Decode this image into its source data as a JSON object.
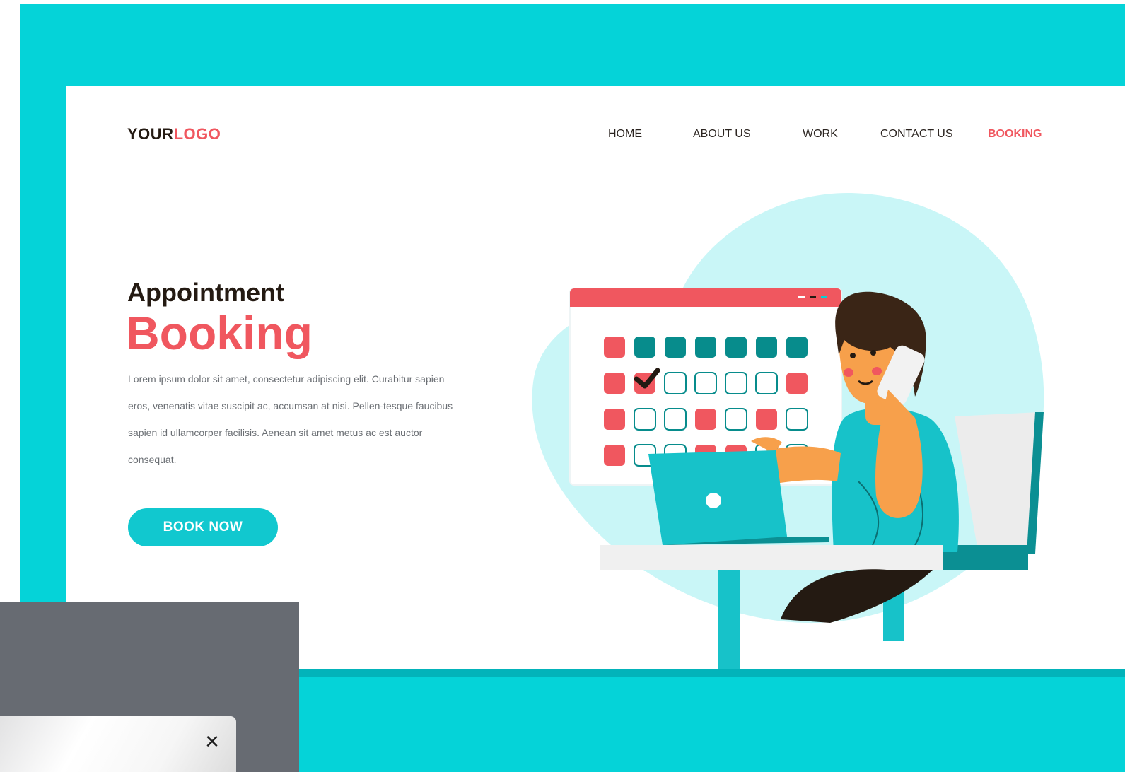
{
  "header": {
    "logo_part1": "YOUR",
    "logo_part2": "LOGO",
    "nav": [
      {
        "label": "HOME"
      },
      {
        "label": "ABOUT US"
      },
      {
        "label": "WORK"
      },
      {
        "label": "CONTACT US"
      },
      {
        "label": "BOOKING",
        "active": true
      }
    ]
  },
  "hero": {
    "title_line1": "Appointment",
    "title_line2": "Booking",
    "body": "Lorem ipsum dolor sit amet, consectetur adipiscing elit. Curabitur sapien eros, venenatis vitae suscipit ac, accumsan at nisi. Pellen-tesque faucibus sapien id ullamcorper facilisis. Aenean sit amet metus ac est auctor consequat.",
    "cta_label": "BOOK NOW"
  },
  "illustration": {
    "name": "person-booking-on-phone-with-calendar-and-laptop"
  },
  "popup": {
    "close_symbol": "✕"
  },
  "colors": {
    "teal": "#05d3d8",
    "coral": "#f0575f",
    "dark_teal": "#078c8c",
    "dark_text": "#241a12"
  }
}
